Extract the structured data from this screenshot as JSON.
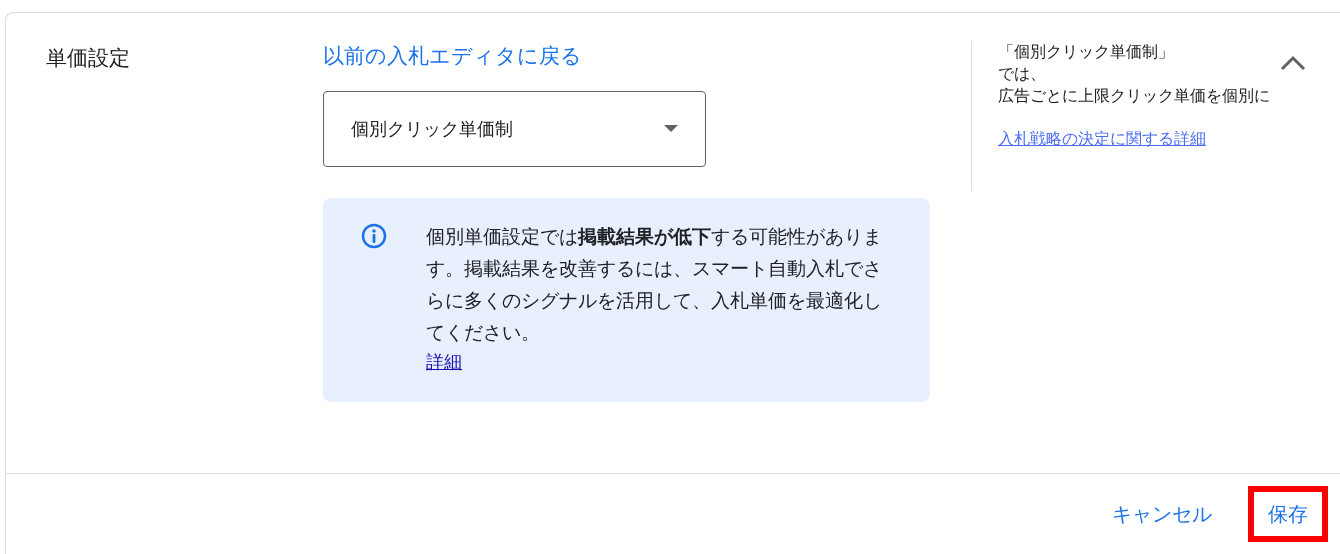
{
  "section": {
    "label": "単価設定",
    "back_link": "以前の入札エディタに戻る",
    "dropdown": {
      "value": "個別クリック単価制"
    },
    "notice": {
      "text": "個別単価設定では**掲載結果が低下**する可能性があります。掲載結果を改善するには、スマート自動入札でさらに多くのシグナルを活用して、入札単価を最適化してください。",
      "link": "詳細"
    },
    "help": {
      "lines": [
        "「個別クリック単価制」",
        "では、",
        "広告ごとに上限クリック単価を個別に"
      ],
      "link": "入札戦略の決定に関する詳細",
      "expanded": true
    }
  },
  "footer": {
    "buttons": [
      {
        "label": "キャンセル",
        "highlighted": false
      },
      {
        "label": "保存",
        "highlighted": true
      }
    ]
  }
}
